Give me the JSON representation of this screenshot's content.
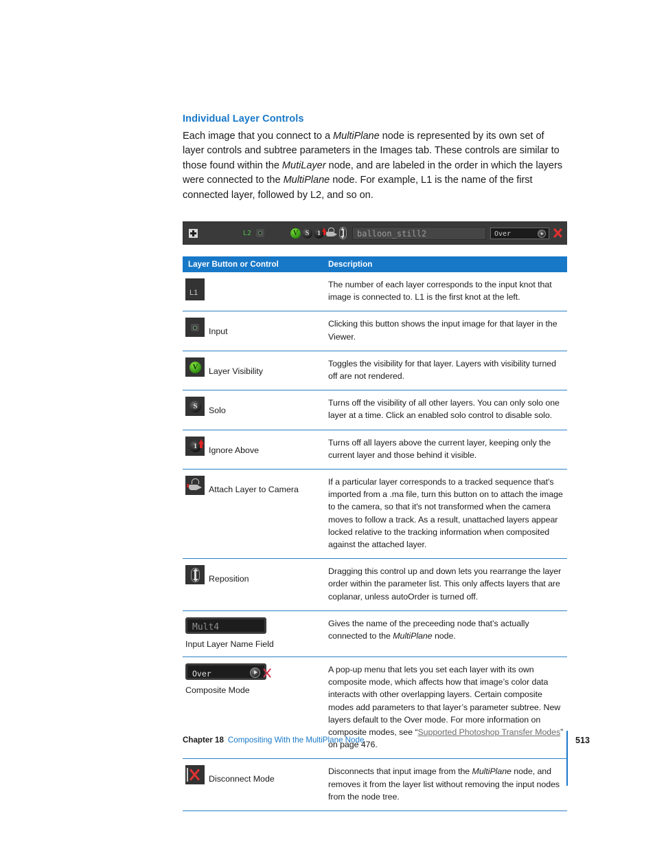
{
  "section": {
    "heading": "Individual Layer Controls",
    "intro_part1": "Each image that you connect to a ",
    "intro_em1": "MultiPlane",
    "intro_part2": " node is represented by its own set of layer controls and subtree parameters in the Images tab. These controls are similar to those found within the ",
    "intro_em2": "MutiLayer",
    "intro_part3": " node, and are labeled in the order in which the layers were connected to the ",
    "intro_em3": "MultiPlane",
    "intro_part4": " node. For example, L1 is the name of the first connected layer, followed by L2, and so on."
  },
  "node_strip": {
    "layer_id": "L2",
    "name_field_value": "balloon_still2",
    "composite_mode_value": "Over",
    "icons": [
      "expand-icon",
      "input-icon",
      "layer-visibility-icon",
      "solo-icon",
      "ignore-above-icon",
      "attach-camera-icon",
      "reposition-icon",
      "disconnect-icon"
    ]
  },
  "table": {
    "headers": {
      "col1": "Layer Button or Control",
      "col2": "Description"
    },
    "rows": [
      {
        "control_kind": "swatch-text",
        "swatch_text": "L1",
        "label": "",
        "description_html": "The number of each layer corresponds to the input knot that image is connected to. L1 is the first knot at the left."
      },
      {
        "control_kind": "icon-input",
        "label": "Input",
        "description_html": "Clicking this button shows the input image for that layer in the Viewer."
      },
      {
        "control_kind": "icon-visibility",
        "swatch_text": "V",
        "label": "Layer Visibility",
        "description_html": "Toggles the visibility for that layer. Layers with visibility turned off are not rendered."
      },
      {
        "control_kind": "icon-solo",
        "swatch_text": "S",
        "label": "Solo",
        "description_html": "Turns off the visibility of all other layers. You can only solo one layer at a time. Click an enabled solo control to disable solo."
      },
      {
        "control_kind": "icon-ignore",
        "swatch_text": "1",
        "label": "Ignore Above",
        "description_html": "Turns off all layers above the current layer, keeping only the current layer and those behind it visible."
      },
      {
        "control_kind": "icon-camera",
        "label": "Attach Layer to Camera",
        "description_html": "If a particular layer corresponds to a tracked sequence that's imported from a .ma file, turn this button on to attach the image to the camera, so that it's not transformed when the camera moves to follow a track. As a result, unattached layers appear locked relative to the tracking information when composited against the attached layer."
      },
      {
        "control_kind": "icon-reposition",
        "label": "Reposition",
        "description_html": "Dragging this control up and down lets you rearrange the layer order within the parameter list. This only affects layers that are coplanar, unless autoOrder is turned off."
      },
      {
        "control_kind": "widget-namefield",
        "field_value": "Mult4",
        "caption": "Input Layer Name Field",
        "description_html": "Gives the name of the preceeding node that's actually connected to the MultiPlane node."
      },
      {
        "control_kind": "widget-popup",
        "field_value": "Over",
        "caption": "Composite Mode",
        "description_html": "A pop-up menu that lets you set each layer with its own composite mode, which affects how that image's color data interacts with other overlapping layers. Certain composite modes add parameters to that layer's parameter subtree. New layers default to the Over mode. For more information on composite modes, see \"Supported Photoshop Transfer Modes\" on page 476.",
        "link_text": "Supported Photoshop Transfer Modes",
        "link_page": "476"
      },
      {
        "control_kind": "icon-disconnect",
        "label": "Disconnect Mode",
        "description_html": "Disconnects that input image from the MultiPlane node, and removes it from the layer list without removing the input nodes from the node tree."
      }
    ]
  },
  "footer": {
    "chapter": "Chapter 18",
    "title": "Compositing With the MultiPlane Node",
    "page_number": "513"
  },
  "colors": {
    "accent_blue": "#1878c8",
    "link_gray": "#6b6b6b",
    "widget_dark": "#1d1d1d",
    "green": "#2f8f12",
    "red": "#e02222"
  }
}
